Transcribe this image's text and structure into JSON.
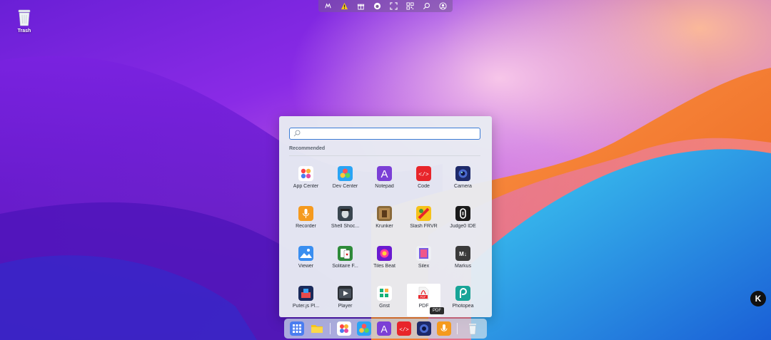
{
  "desktop": {
    "trash_label": "Trash"
  },
  "top_bar": {
    "icons": [
      "puter-logo-icon",
      "warning-icon",
      "gift-icon",
      "github-icon",
      "fullscreen-icon",
      "qr-code-icon",
      "search-icon",
      "account-icon"
    ]
  },
  "launcher": {
    "search_placeholder": "",
    "section_title": "Recommended",
    "apps": [
      {
        "name": "App Center"
      },
      {
        "name": "Dev Center"
      },
      {
        "name": "Notepad"
      },
      {
        "name": "Code"
      },
      {
        "name": "Camera"
      },
      {
        "name": "Recorder"
      },
      {
        "name": "Shell Shoc..."
      },
      {
        "name": "Krunker"
      },
      {
        "name": "Slash FRVR"
      },
      {
        "name": "Judge0 IDE"
      },
      {
        "name": "Viewer"
      },
      {
        "name": "Solitaire F..."
      },
      {
        "name": "Tiles Beat"
      },
      {
        "name": "Silex"
      },
      {
        "name": "Markus"
      },
      {
        "name": "Puter.js Pl..."
      },
      {
        "name": "Player"
      },
      {
        "name": "Grist"
      },
      {
        "name": "PDF"
      },
      {
        "name": "Photopea"
      }
    ],
    "tooltip": "PDF"
  },
  "dock": {
    "items": [
      "app-launcher",
      "files",
      "app-center",
      "dev-center",
      "notepad",
      "code",
      "camera",
      "recorder",
      "trash"
    ]
  },
  "widget": {
    "label": "K"
  },
  "colors": {
    "accent": "#3a7bd5",
    "dock_bg": "#c8dceb",
    "launcher_bg": "#e8ecf2"
  }
}
